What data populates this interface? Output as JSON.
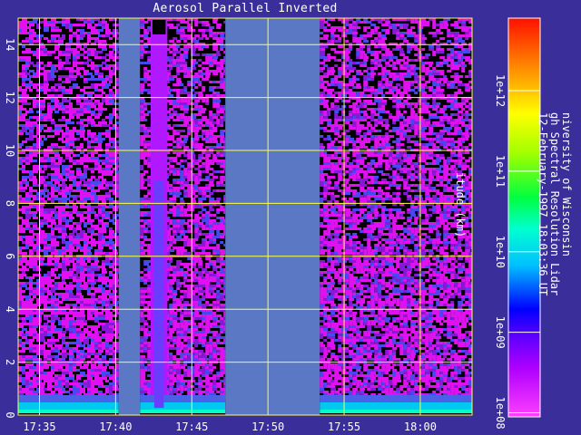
{
  "chart_data": {
    "type": "heatmap",
    "title": "Aerosol Parallel Inverted",
    "ylabel": "itude (km)",
    "x_ticks": [
      "17:35",
      "17:40",
      "17:45",
      "17:50",
      "17:55",
      "18:00"
    ],
    "x_tick_minutes": [
      35,
      40,
      45,
      50,
      55,
      60
    ],
    "xlim_minutes": [
      33.6,
      63.4
    ],
    "y_ticks": [
      0,
      2,
      4,
      6,
      8,
      10,
      12,
      14
    ],
    "ylim": [
      0,
      15
    ],
    "grid": true,
    "colorbar": {
      "scale": "log",
      "ticks": [
        "1e+08",
        "1e+09",
        "1e+10",
        "1e+11",
        "1e+12"
      ],
      "tick_values_log10": [
        8,
        9,
        10,
        11,
        12
      ],
      "range_log10": [
        7.95,
        12.9
      ]
    },
    "no_data_intervals_minutes": [
      [
        40.2,
        41.6
      ],
      [
        47.2,
        53.4
      ]
    ],
    "data_segments_minutes": [
      [
        33.6,
        40.2
      ],
      [
        41.6,
        47.2
      ],
      [
        53.4,
        63.4
      ]
    ]
  },
  "annotation": {
    "line1": "niversity of Wisconsin",
    "line2": "gh Spectral Resolution Lidar",
    "line3": "12-February-1997 18:03:36 UT"
  },
  "colors": {
    "background": "#3a2f9a",
    "no_data": "#5a78c4",
    "grid": "#ffff40",
    "noise_magenta": "#e010f0",
    "noise_purple": "#8818d8",
    "noise_blue": "#4848f0"
  }
}
